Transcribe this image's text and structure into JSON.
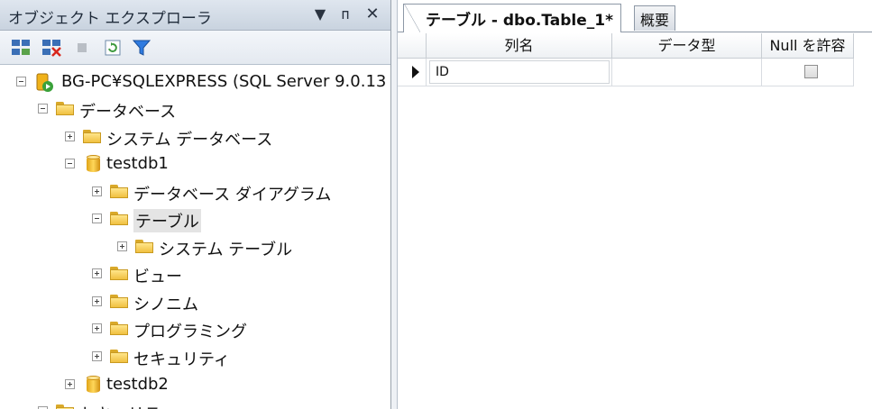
{
  "object_explorer": {
    "title": "オブジェクト エクスプローラ",
    "title_buttons": {
      "dropdown": "▼",
      "pin": "ᴨ",
      "close": "✕"
    },
    "toolbar": [
      "connect-icon",
      "disconnect-icon",
      "stop-icon",
      "refresh-icon",
      "filter-icon"
    ],
    "tree": {
      "server": "BG-PC¥SQLEXPRESS (SQL Server 9.0.13",
      "databases": "データベース",
      "system_databases": "システム データベース",
      "testdb1": "testdb1",
      "diagrams": "データベース ダイアグラム",
      "tables": "テーブル",
      "system_tables": "システム テーブル",
      "views": "ビュー",
      "synonyms": "シノニム",
      "programmability": "プログラミング",
      "security": "セキュリティ",
      "testdb2": "testdb2",
      "security_root": "セキュリティ"
    }
  },
  "document": {
    "tabs": [
      {
        "label": "テーブル - dbo.Table_1*",
        "active": true
      },
      {
        "label": "概要",
        "active": false
      }
    ],
    "grid": {
      "columns": [
        "列名",
        "データ型",
        "Null を許容"
      ],
      "rows": [
        {
          "column_name": "ID",
          "data_type": "",
          "allow_null": false
        }
      ]
    }
  },
  "colors": {
    "folder": "#f0c040",
    "database": "#e0a417",
    "accent": "#8d98a6"
  }
}
